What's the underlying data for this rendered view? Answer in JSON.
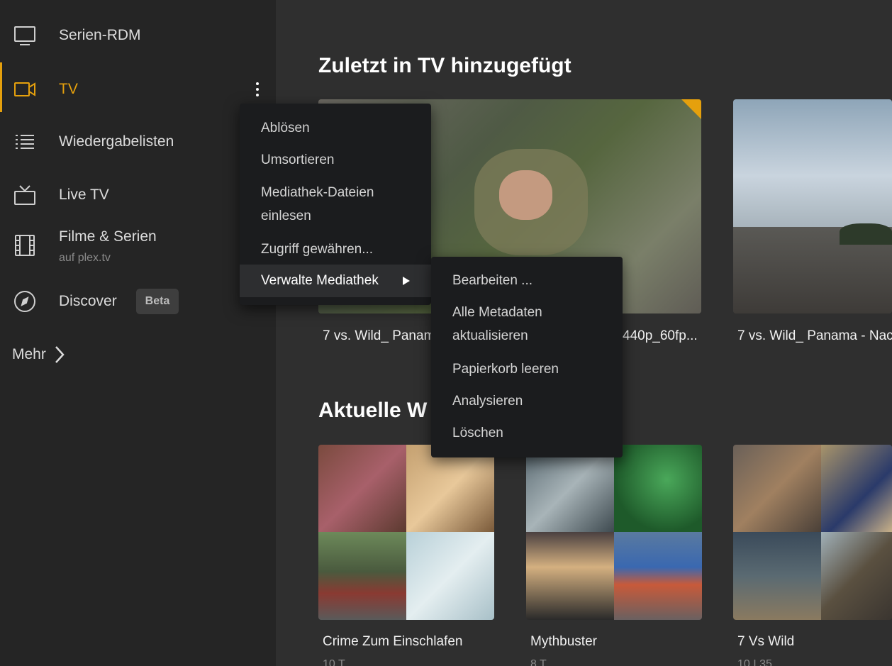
{
  "sidebar": {
    "items": [
      {
        "label": "Serien-RDM",
        "icon": "monitor-icon"
      },
      {
        "label": "TV",
        "icon": "video-camera-icon",
        "active": true
      },
      {
        "label": "Wiedergabelisten",
        "icon": "list-icon"
      },
      {
        "label": "Live TV",
        "icon": "tv-antenna-icon"
      },
      {
        "label": "Filme & Serien",
        "sub": "auf plex.tv",
        "icon": "film-icon"
      },
      {
        "label": "Discover",
        "badge": "Beta",
        "icon": "compass-icon"
      }
    ],
    "more_label": "Mehr"
  },
  "colors": {
    "accent": "#e5a00d",
    "background": "#2f2f2f",
    "sidebar": "#252525",
    "menu": "#1b1c1e"
  },
  "sections": [
    {
      "title": "Zuletzt in TV hinzugefügt",
      "items": [
        {
          "title": "7 vs. Wild_ Panama"
        },
        {
          "title": "440p_60fp..."
        },
        {
          "title": "7 vs. Wild_ Panama - Nac"
        }
      ]
    },
    {
      "title": "Aktuelle W",
      "items": [
        {
          "title": "Crime Zum Einschlafen",
          "sub": "10 T"
        },
        {
          "title": "Mythbuster",
          "sub": "8 T"
        },
        {
          "title": "7 Vs Wild",
          "sub": "10 I 35"
        }
      ]
    }
  ],
  "context_menu": {
    "items": [
      "Ablösen",
      "Umsortieren",
      "Mediathek-Dateien einlesen",
      "Zugriff gewähren...",
      "Verwalte Mediathek"
    ]
  },
  "submenu": {
    "items": [
      "Bearbeiten ...",
      "Alle Metadaten aktualisieren",
      "Papierkorb leeren",
      "Analysieren",
      "Löschen"
    ]
  }
}
